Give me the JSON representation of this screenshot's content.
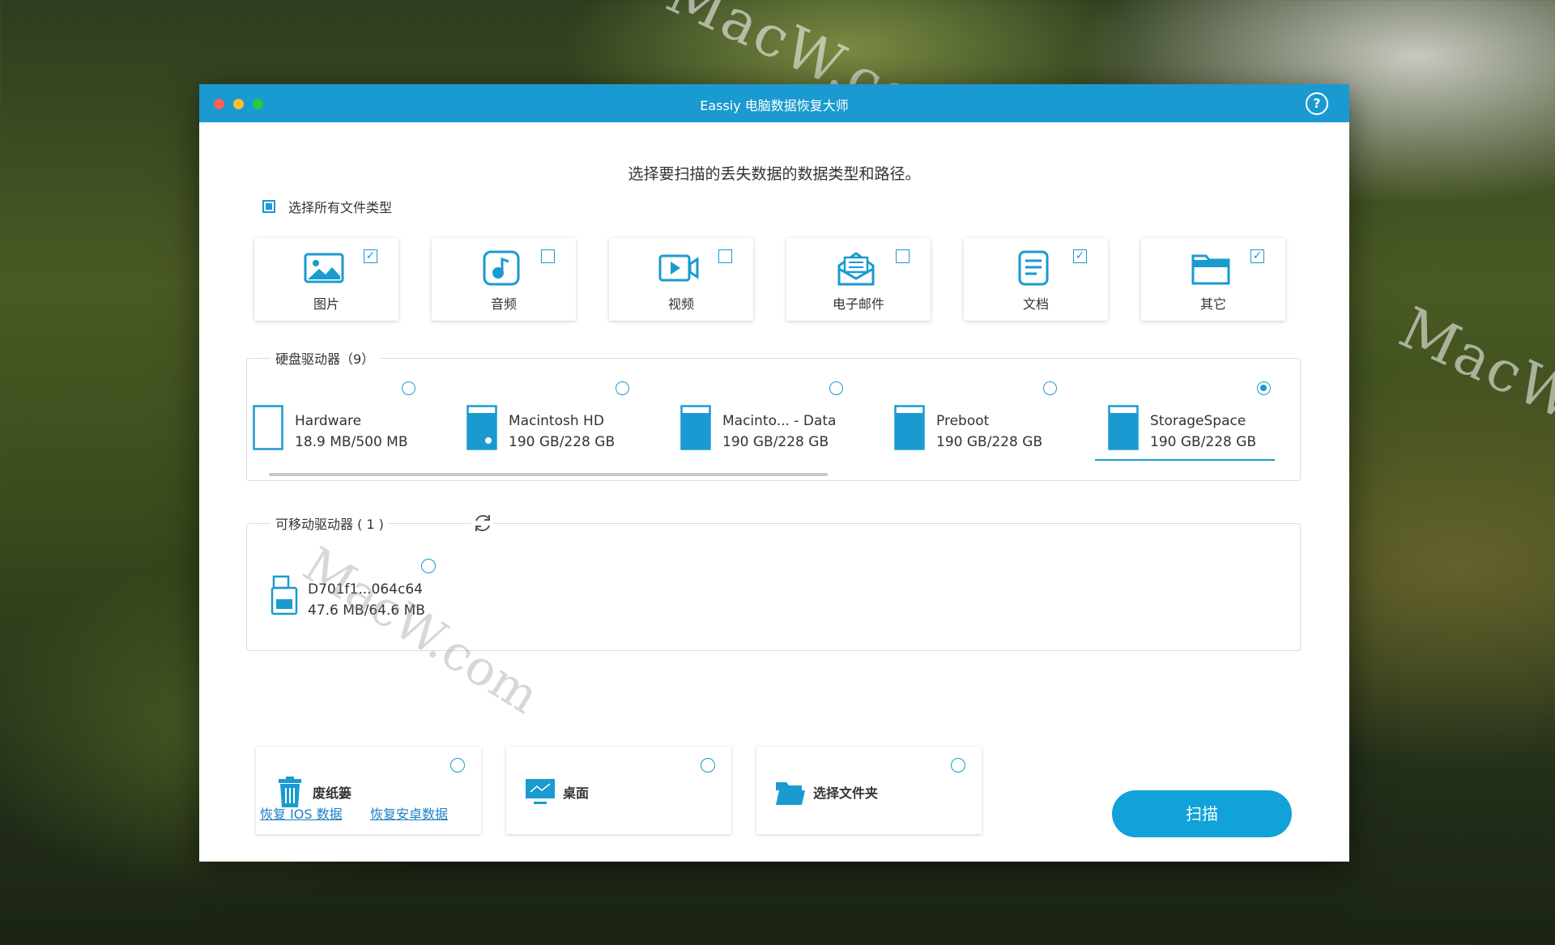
{
  "window": {
    "title": "Eassiy 电脑数据恢复大师",
    "help_label": "?"
  },
  "headline": "选择要扫描的丢失数据的数据类型和路径。",
  "select_all": {
    "label": "选择所有文件类型",
    "checked": "partial"
  },
  "file_types": [
    {
      "label": "图片",
      "icon": "image-icon",
      "checked": true
    },
    {
      "label": "音频",
      "icon": "audio-icon",
      "checked": false
    },
    {
      "label": "视频",
      "icon": "video-icon",
      "checked": false
    },
    {
      "label": "电子邮件",
      "icon": "email-icon",
      "checked": false
    },
    {
      "label": "文档",
      "icon": "document-icon",
      "checked": true
    },
    {
      "label": "其它",
      "icon": "folder-icon",
      "checked": true
    }
  ],
  "hard_drives": {
    "label": "硬盘驱动器（9）",
    "items": [
      {
        "name": "Hardware",
        "size": "18.9 MB/500 MB",
        "selected": false,
        "fill": 0.04
      },
      {
        "name": "Macintosh HD",
        "size": "190 GB/228 GB",
        "selected": false,
        "fill": 0.83
      },
      {
        "name": "Macinto... - Data",
        "size": "190 GB/228 GB",
        "selected": false,
        "fill": 0.83
      },
      {
        "name": "Preboot",
        "size": "190 GB/228 GB",
        "selected": false,
        "fill": 0.83
      },
      {
        "name": "StorageSpace",
        "size": "190 GB/228 GB",
        "selected": true,
        "fill": 0.83
      }
    ]
  },
  "removable_drives": {
    "label": "可移动驱动器 ( 1 )",
    "items": [
      {
        "name": "D701f1...064c64",
        "size": "47.6 MB/64.6 MB",
        "selected": false
      }
    ]
  },
  "shortcuts": [
    {
      "label": "废纸篓",
      "icon": "trash-icon"
    },
    {
      "label": "桌面",
      "icon": "desktop-icon"
    },
    {
      "label": "选择文件夹",
      "icon": "open-folder-icon"
    }
  ],
  "links": {
    "ios": "恢复 IOS 数据",
    "android": "恢复安卓数据"
  },
  "scan_button": "扫描",
  "colors": {
    "accent": "#1a9ad0",
    "titlebar": "#1a9ad0"
  }
}
